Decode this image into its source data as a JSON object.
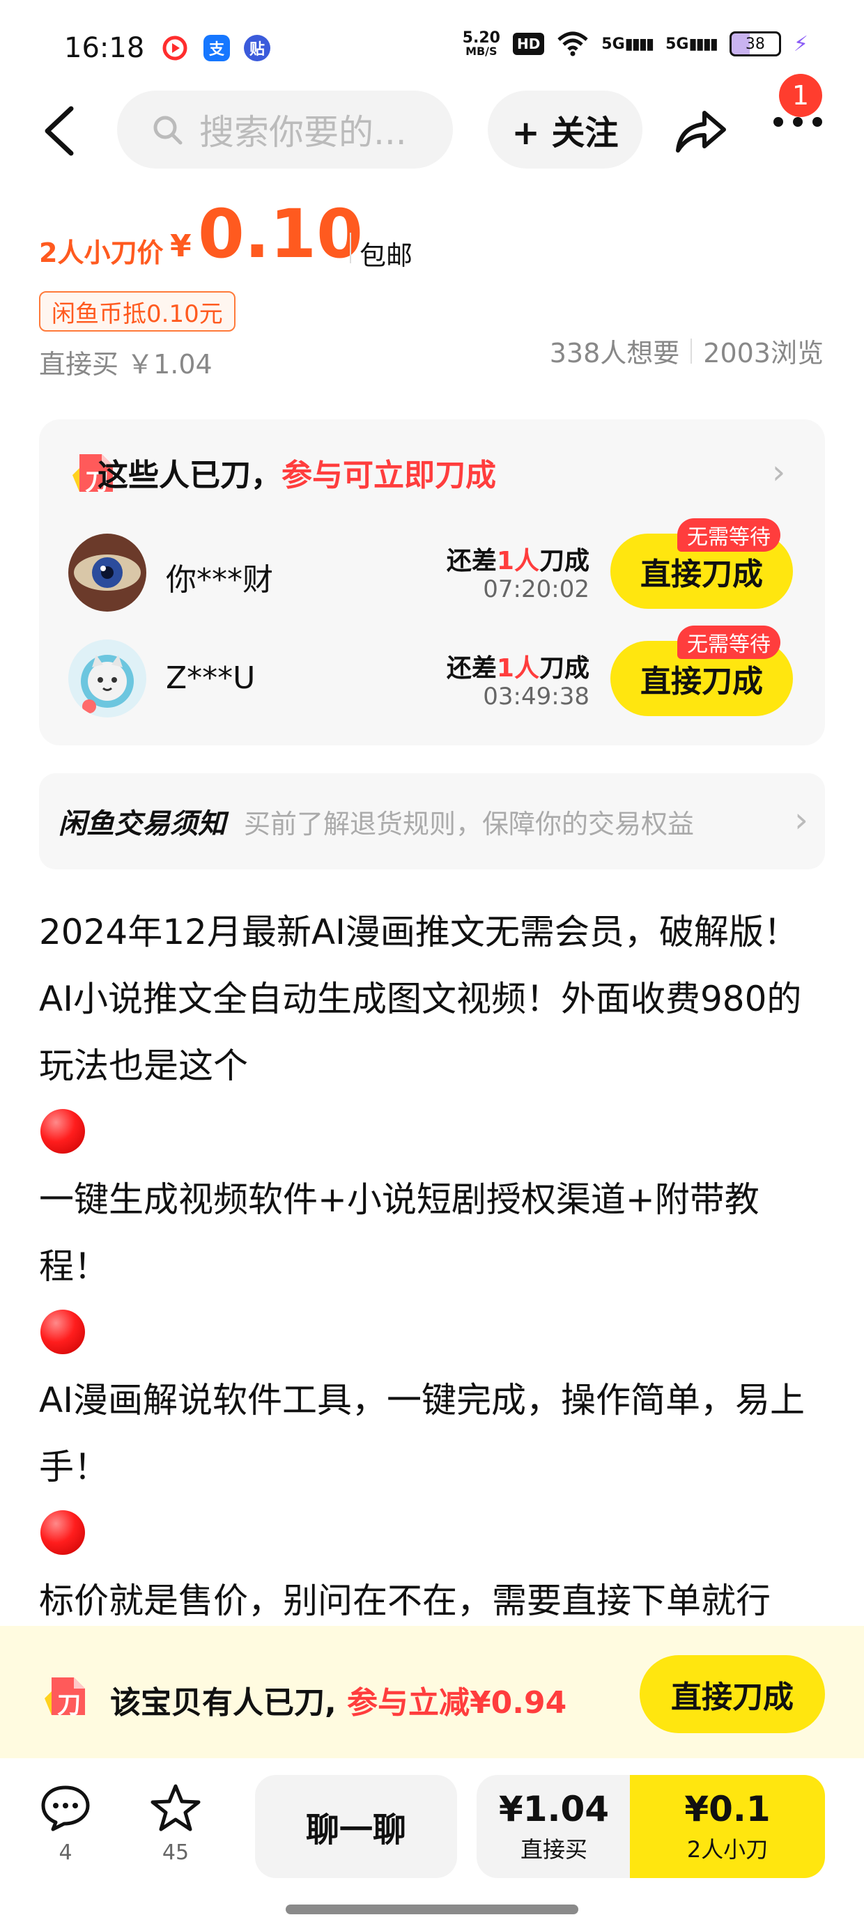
{
  "status_bar": {
    "time": "16:18",
    "net_speed_value": "5.20",
    "net_speed_unit": "MB/S",
    "hd": "HD",
    "signal1": "5G",
    "signal2": "5G",
    "battery": "38",
    "apps": [
      "red-circle-app-icon",
      "alipay-icon",
      "tieba-icon"
    ],
    "alipay_glyph": "支",
    "tieba_glyph": "贴"
  },
  "header": {
    "search_placeholder": "搜索你要的...",
    "follow_label": "+ 关注",
    "message_count": "1"
  },
  "price": {
    "label": "2人小刀价",
    "currency": "¥",
    "value": "0.10",
    "shipping": "包邮",
    "coin_discount": "闲鱼币抵0.10元",
    "direct_buy": "直接买 ￥1.04",
    "wants": "338人想要",
    "views": "2003浏览"
  },
  "bargain_card": {
    "icon_glyph": "刀",
    "title_main": "这些人已刀，",
    "title_highlight": "参与可立即刀成",
    "rows": [
      {
        "name": "你***财",
        "remain_pre": "还差",
        "remain_num": "1人",
        "remain_post": "刀成",
        "timer": "07:20:02",
        "badge": "无需等待",
        "button": "直接刀成"
      },
      {
        "name": "Z***U",
        "remain_pre": "还差",
        "remain_num": "1人",
        "remain_post": "刀成",
        "timer": "03:49:38",
        "badge": "无需等待",
        "button": "直接刀成"
      }
    ]
  },
  "notice": {
    "logo": "闲鱼交易须知",
    "text": "买前了解退货规则，保障你的交易权益"
  },
  "description": {
    "p1": "2024年12月最新AI漫画推文无需会员，破解版！AI小说推文全自动生成图文视频！外面收费980的玩法也是这个",
    "p2": "一键生成视频软件+小说短剧授权渠道+附带教程！",
    "p3": "AI漫画解说软件工具，一键完成，操作简单，易上手！",
    "p4": "标价就是售价，别问在不在，需要直接下单就行了！"
  },
  "promo": {
    "icon_glyph": "刀",
    "text_main": "该宝贝有人已刀,",
    "text_highlight": "参与立减¥0.94",
    "button": "直接刀成"
  },
  "bottom_bar": {
    "comment_count": "4",
    "favorite_count": "45",
    "chat_label": "聊一聊",
    "buy_price": "¥1.04",
    "buy_label": "直接买",
    "small_price": "¥0.1",
    "small_label": "2人小刀"
  },
  "colors": {
    "accent_orange": "#ff5a1f",
    "accent_red": "#ff3d3d",
    "brand_yellow": "#ffe60f"
  }
}
